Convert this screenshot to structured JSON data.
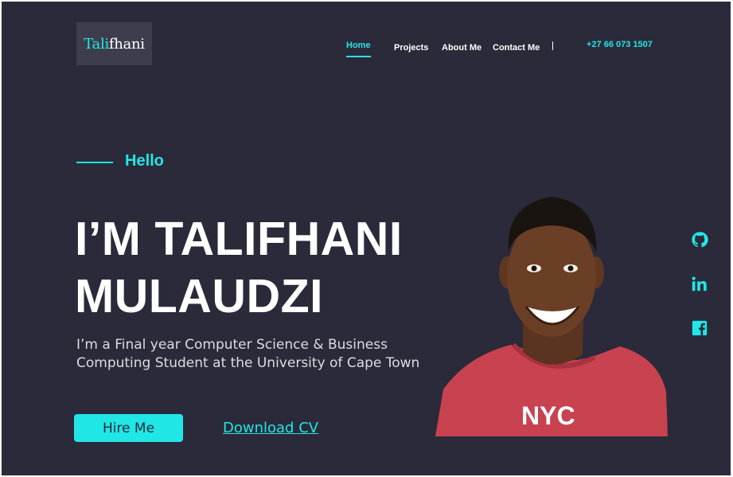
{
  "brand": {
    "logo_prefix": "Tali",
    "logo_suffix": "fhani"
  },
  "nav": {
    "items": [
      {
        "label": "Home",
        "active": true
      },
      {
        "label": "Projects"
      },
      {
        "label": "About Me"
      },
      {
        "label": "Contact Me"
      }
    ],
    "separator": "|",
    "phone": "+27 66 073 1507"
  },
  "hero": {
    "greeting": "Hello",
    "headline_line1": "I’M TALIFHANI",
    "headline_line2": "MULAUDZI",
    "subtitle_line1": "I’m a Final year Computer Science & Business",
    "subtitle_line2": "Computing Student at the University of  Cape Town",
    "hire_label": "Hire Me",
    "download_label": "Download CV",
    "photo_shirt_text": "NYC"
  },
  "socials": [
    {
      "icon": "github-icon"
    },
    {
      "icon": "linkedin-icon"
    },
    {
      "icon": "facebook-icon"
    }
  ],
  "colors": {
    "background": "#2b2a3a",
    "accent": "#21e6e6",
    "logo_bg": "#3e3d4d",
    "text": "#ffffff"
  }
}
